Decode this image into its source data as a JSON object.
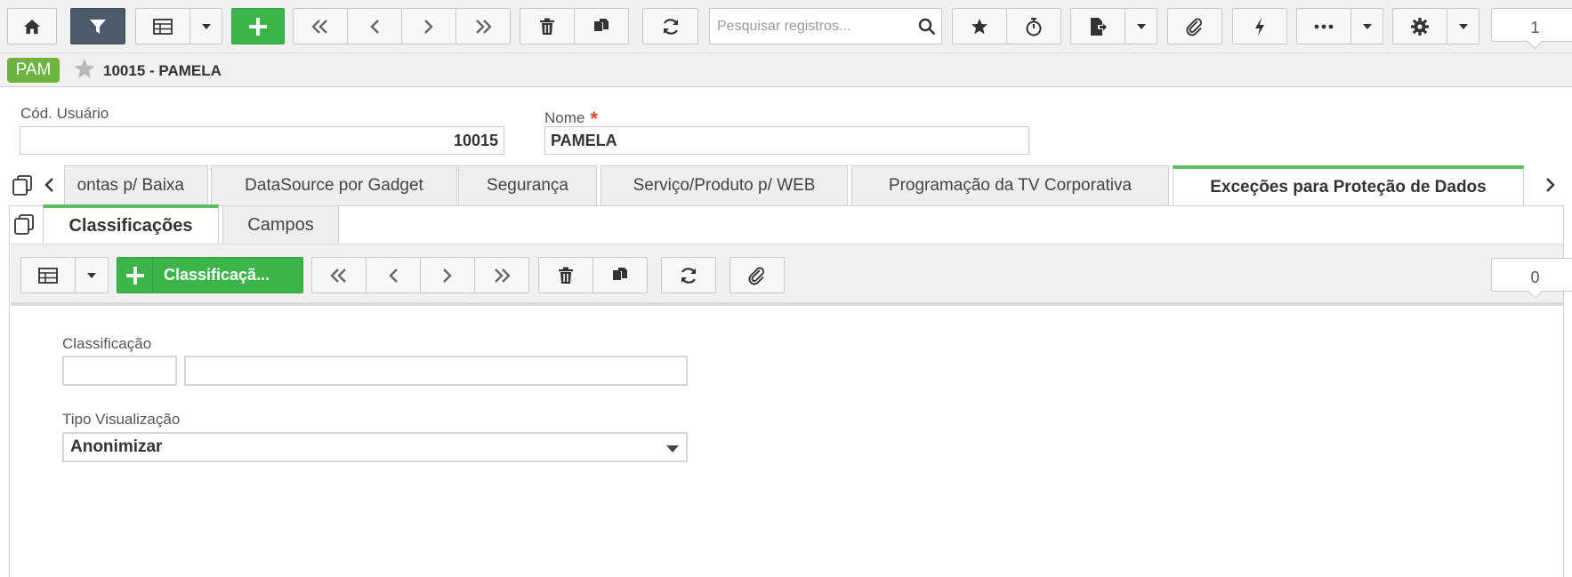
{
  "toolbar": {
    "search_placeholder": "Pesquisar registros...",
    "record_counter": "1",
    "icons": [
      "home-icon",
      "filter-icon",
      "grid-view-icon",
      "chevron-down-icon",
      "plus-icon",
      "first-record-icon",
      "previous-record-icon",
      "next-record-icon",
      "last-record-icon",
      "trash-icon",
      "copy-icon",
      "refresh-icon",
      "search-icon",
      "star-icon",
      "stopwatch-icon",
      "export-icon",
      "paperclip-icon",
      "lightning-icon",
      "more-icon",
      "gear-icon"
    ]
  },
  "record": {
    "badge": "PAM",
    "title": "10015 - PAMELA"
  },
  "form": {
    "code_label": "Cód. Usuário",
    "code_value": "10015",
    "name_label": "Nome",
    "name_required_mark": "*",
    "name_value": "PAMELA"
  },
  "tabs": [
    {
      "label": "ontas p/ Baixa"
    },
    {
      "label": "DataSource por Gadget"
    },
    {
      "label": "Segurança"
    },
    {
      "label": "Serviço/Produto p/ WEB"
    },
    {
      "label": "Programação da TV Corporativa"
    },
    {
      "label": "Exceções para Proteção de Dados",
      "active": true
    }
  ],
  "subtabs": [
    {
      "label": "Classificações",
      "active": true
    },
    {
      "label": "Campos"
    }
  ],
  "subtoolbar": {
    "add_label": "Classificaçã...",
    "record_counter": "0"
  },
  "detail": {
    "classification_label": "Classificação",
    "classification_code": "",
    "classification_description": "",
    "view_type_label": "Tipo Visualização",
    "view_type_value": "Anonimizar"
  },
  "colors": {
    "accent_green": "#3cb54a",
    "badge_green": "#6db33f",
    "dark_button": "#4b5b6b",
    "required_red": "#e0412b"
  }
}
